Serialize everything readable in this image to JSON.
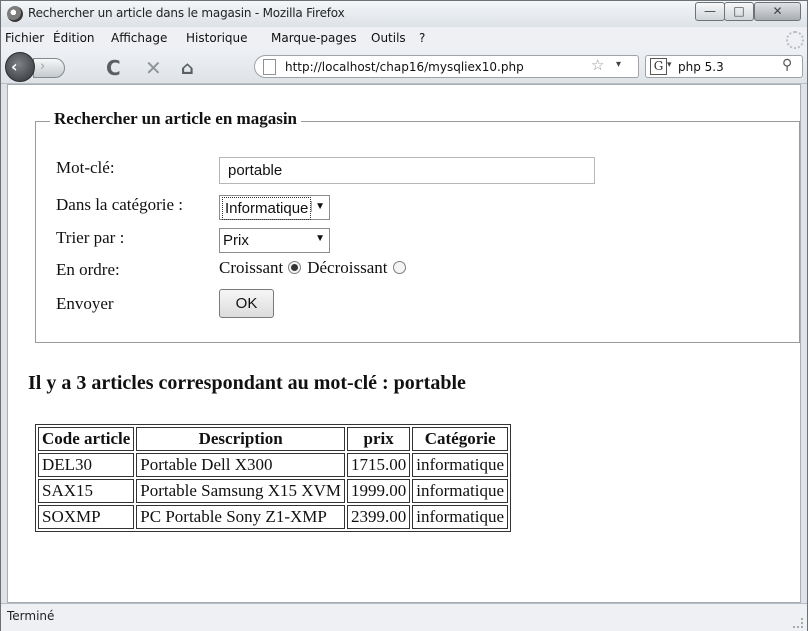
{
  "window": {
    "title": "Rechercher un article dans le magasin - Mozilla Firefox",
    "controls": {
      "minimize": "—",
      "maximize": "□",
      "close": "✕"
    }
  },
  "menu": [
    "Fichier",
    "Édition",
    "Affichage",
    "Historique",
    "Marque-pages",
    "Outils",
    "?"
  ],
  "nav": {
    "url": "http://localhost/chap16/mysqliex10.php",
    "search_engine_icon": "G",
    "search_value": "php 5.3",
    "icons": {
      "back": "‹",
      "forward": "›",
      "reload": "C",
      "stop": "✕",
      "home": "⌂",
      "star": "☆",
      "dropdown": "▾",
      "search": "⚲"
    }
  },
  "form": {
    "legend": "Rechercher un article en magasin",
    "keyword_label": "Mot-clé:",
    "keyword_value": "portable",
    "category_label": "Dans la catégorie :",
    "category_value": "Informatique",
    "sort_label": "Trier par :",
    "sort_value": "Prix",
    "order_label": "En ordre:",
    "order_asc": "Croissant",
    "order_desc": "Décroissant",
    "order_selected": "Croissant",
    "submit_label": "Envoyer",
    "submit_button": "OK",
    "dropdown_arrow": "▼"
  },
  "result_heading": "Il y a 3 articles correspondant au mot-clé : portable",
  "table": {
    "headers": [
      "Code article",
      "Description",
      "prix",
      "Catégorie"
    ],
    "rows": [
      [
        "DEL30",
        "Portable Dell X300",
        "1715.00",
        "informatique"
      ],
      [
        "SAX15",
        "Portable Samsung X15 XVM",
        "1999.00",
        "informatique"
      ],
      [
        "SOXMP",
        "PC Portable Sony Z1-XMP",
        "2399.00",
        "informatique"
      ]
    ]
  },
  "status": "Terminé"
}
